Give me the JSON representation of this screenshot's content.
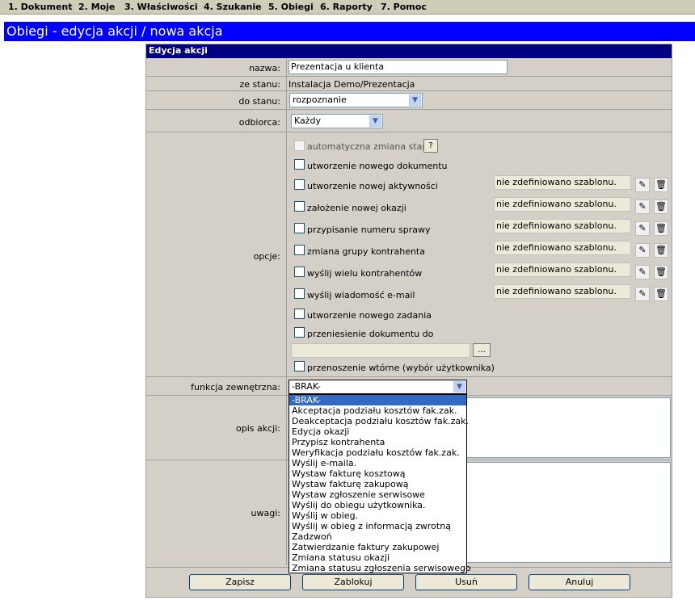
{
  "menu": [
    "1. Dokument",
    "2. Moje",
    "3. Właściwości",
    "4. Szukanie",
    "5. Obiegi",
    "6. Raporty",
    "7. Pomoc"
  ],
  "page_title": "Obiegi - edycja akcji / nowa akcja",
  "form": {
    "header": "Edycja akcji",
    "nazwa_label": "nazwa:",
    "nazwa_value": "Prezentacja u klienta",
    "ze_stanu_label": "ze stanu:",
    "ze_stanu_value": "Instalacja Demo/Prezentacja",
    "do_stanu_label": "do stanu:",
    "do_stanu_value": "rozpoznanie",
    "odbiorca_label": "odbiorca:",
    "odbiorca_value": "Każdy",
    "opcje_label": "opcje:",
    "options": {
      "auto": "automatyczna zmiana stanu",
      "help": "?",
      "doc": "utworzenie nowego dokumentu",
      "activity": "utworzenie nowej aktywności",
      "okazja": "założenie nowej okazji",
      "numer": "przypisanie numeru sprawy",
      "grupa": "zmiana grupy kontrahenta",
      "wielu": "wyślij wielu kontrahentów",
      "email": "wyślij wiadomość e-mail",
      "zadanie": "utworzenie nowego zadania",
      "przeniesienie": "przeniesienie dokumentu do",
      "browse": "...",
      "wtorne": "przenoszenie wtórne (wybór użytkownika)"
    },
    "template_placeholder": "nie zdefiniowano szablonu.",
    "funkcja_label": "funkcja zewnętrzna:",
    "funkcja_value": "-BRAK-",
    "opis_label": "opis akcji:",
    "uwagi_label": "uwagi:",
    "funkcja_options": [
      "-BRAK-",
      "Akceptacja podziału kosztów fak.zak.",
      "Deakceptacja podziału kosztów fak.zak.",
      "Edycja okazji",
      "Przypisz kontrahenta",
      "Weryfikacja podziału kosztów fak.zak.",
      "Wyślij e-maila.",
      "Wystaw fakturę kosztową",
      "Wystaw fakturę zakupową",
      "Wystaw zgłoszenie serwisowe",
      "Wyślij do obiegu użytkownika.",
      "Wyślij w obieg.",
      "Wyślij w obieg z informacją zwrotną",
      "Zadzwoń",
      "Zatwierdzanie faktury zakupowej",
      "Zmiana statusu okazji",
      "Zmiana statusu zgłoszenia serwisowego"
    ],
    "buttons": {
      "zapisz": "Zapisz",
      "zablokuj": "Zablokuj",
      "usun": "Usuń",
      "anuluj": "Anuluj"
    }
  }
}
